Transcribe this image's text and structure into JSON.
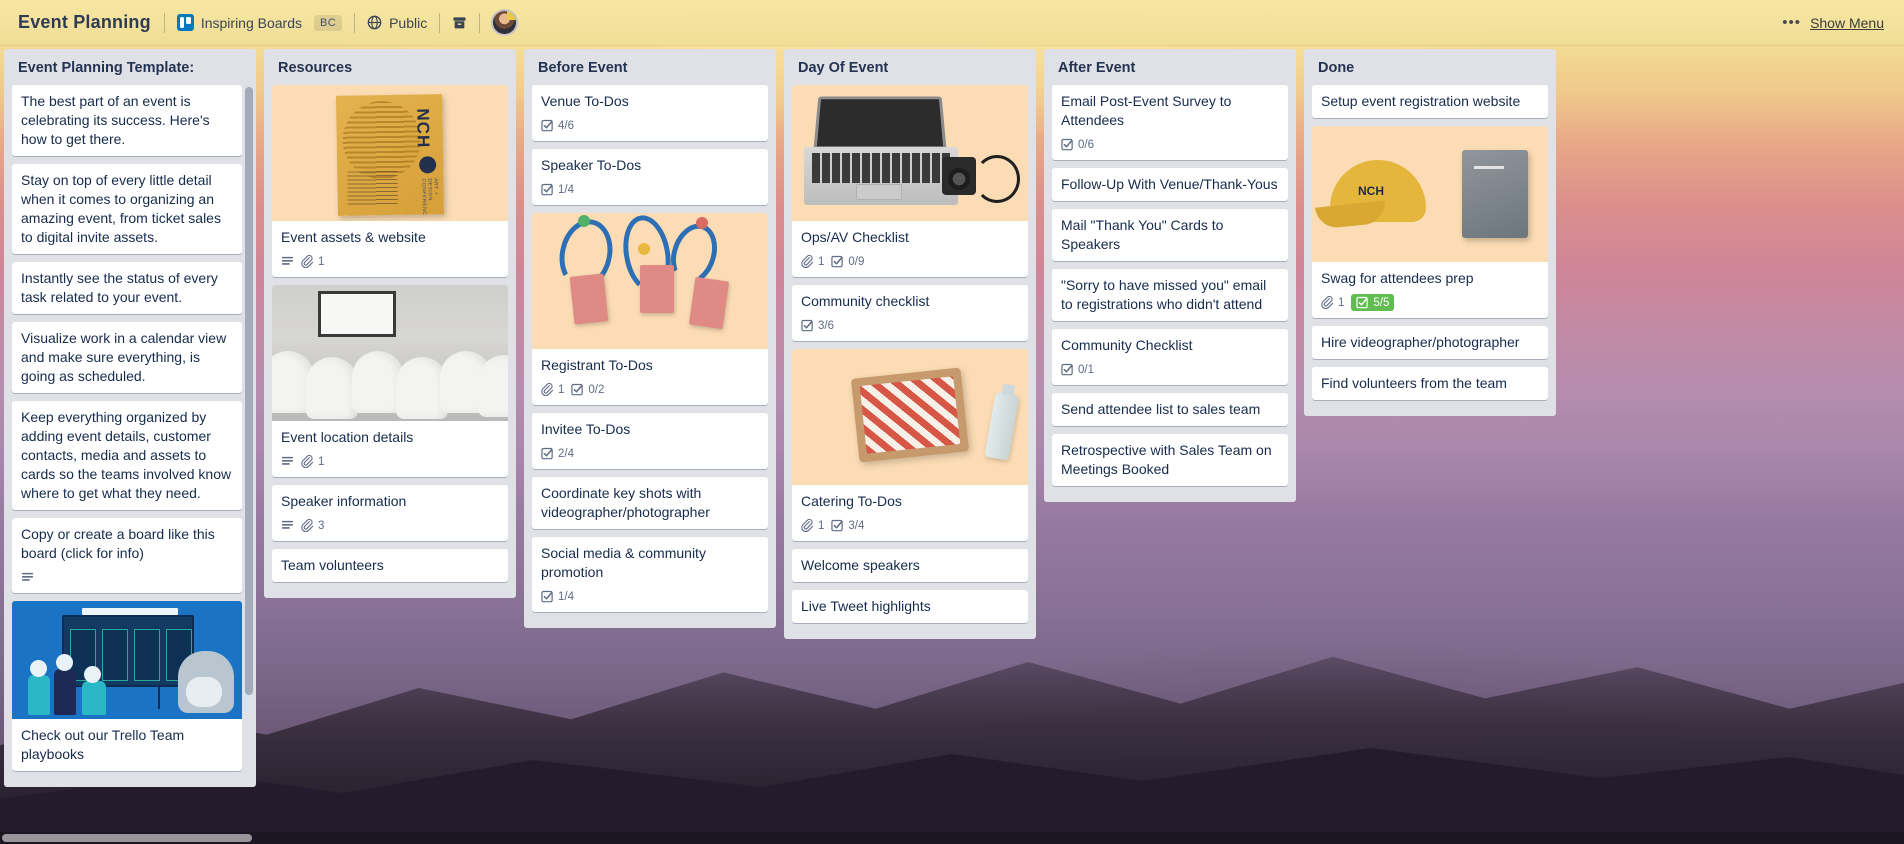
{
  "header": {
    "board_title": "Event Planning",
    "team_name": "Inspiring Boards",
    "team_badge": "BC",
    "visibility": "Public",
    "trello_icon": "trello-logo-icon",
    "globe_icon": "globe-icon",
    "archive_icon": "archive-icon",
    "dots": "•••",
    "show_menu": "Show Menu"
  },
  "lists": [
    {
      "title": "Event Planning Template:",
      "cards": [
        {
          "title": "The best part of an event is celebrating its success. Here's how to get there."
        },
        {
          "title": "Stay on top of every little detail when it comes to organizing an amazing event, from ticket sales to digital invite assets."
        },
        {
          "title": "Instantly see the status of every task related to your event."
        },
        {
          "title": "Visualize work in a calendar view and make sure everything, is going as scheduled."
        },
        {
          "title": "Keep everything organized by adding event details, customer contacts, media and assets to cards so the teams involved know where to get what they need."
        },
        {
          "title": "Copy or create a board like this board (click for info)",
          "description": true
        },
        {
          "title": "Check out our Trello Team playbooks",
          "cover": "promo"
        }
      ]
    },
    {
      "title": "Resources",
      "cards": [
        {
          "title": "Event assets & website",
          "cover": "poster",
          "description": true,
          "attachments": "1"
        },
        {
          "title": "Event location details",
          "cover": "venue",
          "description": true,
          "attachments": "1"
        },
        {
          "title": "Speaker information",
          "description": true,
          "attachments": "3"
        },
        {
          "title": "Team volunteers"
        }
      ]
    },
    {
      "title": "Before Event",
      "cards": [
        {
          "title": "Venue To-Dos",
          "checklist": "4/6"
        },
        {
          "title": "Speaker To-Dos",
          "checklist": "1/4"
        },
        {
          "title": "Registrant To-Dos",
          "cover": "lanyards",
          "attachments": "1",
          "checklist": "0/2"
        },
        {
          "title": "Invitee To-Dos",
          "checklist": "2/4"
        },
        {
          "title": "Coordinate key shots with videographer/photographer"
        },
        {
          "title": "Social media & community promotion",
          "checklist": "1/4"
        }
      ]
    },
    {
      "title": "Day Of Event",
      "cards": [
        {
          "title": "Ops/AV Checklist",
          "cover": "laptop",
          "attachments": "1",
          "checklist": "0/9"
        },
        {
          "title": "Community checklist",
          "checklist": "3/6"
        },
        {
          "title": "Catering To-Dos",
          "cover": "catering",
          "attachments": "1",
          "checklist": "3/4"
        },
        {
          "title": "Welcome speakers"
        },
        {
          "title": "Live Tweet highlights"
        }
      ]
    },
    {
      "title": "After Event",
      "cards": [
        {
          "title": "Email Post-Event Survey to Attendees",
          "checklist": "0/6"
        },
        {
          "title": "Follow-Up With Venue/Thank-Yous"
        },
        {
          "title": "Mail \"Thank You\" Cards to Speakers"
        },
        {
          "title": "\"Sorry to have missed you\" email to registrations who didn't attend"
        },
        {
          "title": "Community Checklist",
          "checklist": "0/1"
        },
        {
          "title": "Send attendee list to sales team"
        },
        {
          "title": "Retrospective with Sales Team on Meetings Booked"
        }
      ]
    },
    {
      "title": "Done",
      "cards": [
        {
          "title": "Setup event registration website"
        },
        {
          "title": "Swag for attendees prep",
          "cover": "swag",
          "attachments": "1",
          "checklist": "5/5",
          "checklist_complete": true
        },
        {
          "title": "Hire videographer/photographer"
        },
        {
          "title": "Find volunteers from the team"
        }
      ]
    }
  ],
  "colors": {
    "list_background": "#dfe1e6",
    "card_background": "#ffffff",
    "card_text": "#172b4d",
    "badge_text": "#5e6c84",
    "checklist_complete": "#61bd4f",
    "header_background": "#f3e29d",
    "trello_blue": "#0079bf"
  }
}
